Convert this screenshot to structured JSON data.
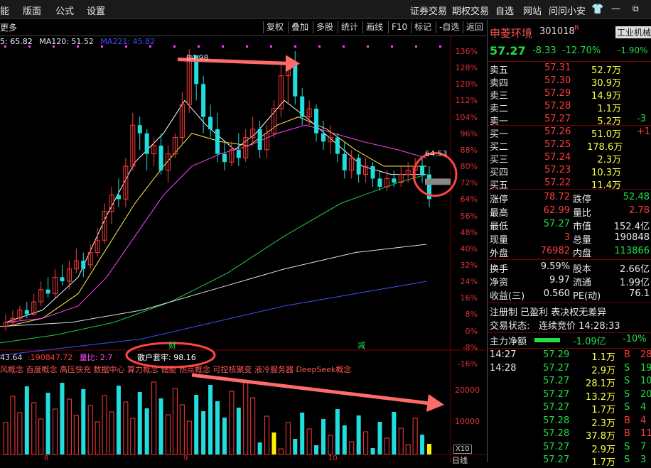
{
  "menubar": {
    "left_items": [
      "能",
      "版面",
      "公式",
      "设置"
    ],
    "right_items": [
      "证券交易",
      "期权交易",
      "自选",
      "网站",
      "问问小安"
    ]
  },
  "toolbar": {
    "more": "更多",
    "buttons": [
      "复权",
      "叠加",
      "多股",
      "统计",
      "画线",
      "F10",
      "标记",
      "-自选",
      "返回"
    ]
  },
  "ma_legend": [
    {
      "text": "5: 65.82",
      "color": "#ffffff"
    },
    {
      "text": "MA120: 51.52",
      "color": "#e8e8e8"
    },
    {
      "text": "MA221: 45.82",
      "color": "#4050ff"
    }
  ],
  "price_axis": [
    "136%",
    "128%",
    "120%",
    "112%",
    "104%",
    "96%",
    "88%",
    "80%",
    "72%",
    "64%",
    "56%",
    "48%",
    "40%",
    "32%",
    "24%",
    "16%",
    "8%",
    "0%",
    "-8%",
    "-16%"
  ],
  "annotations": {
    "high_label": "84.98",
    "current_label": "64.53",
    "marker_cai": "财",
    "marker_jian": "减"
  },
  "volume": {
    "legend_value1": "43.64",
    "legend_value2": "190847.72",
    "legend_ratio_label": "量比: 2.7",
    "retail_label": "散户套牢: 98.16",
    "concepts": "风概念 百度概念 高压快充 数据中心 算力概念 储能 热点概念 可控核聚变 液冷服务器 DeepSeek概念",
    "axis": [
      "20000",
      "10000"
    ],
    "axis_unit": "X10"
  },
  "x_axis": [
    "8",
    "9",
    "10"
  ],
  "stock": {
    "name": "申菱环境",
    "code": "301018",
    "flag": "R",
    "industry": "工业机械",
    "price": "57.27",
    "change": "-8.33",
    "change_pct": "-12.70%",
    "industry_pct": "-1.90%"
  },
  "order_book": {
    "asks": [
      {
        "label": "卖五",
        "price": "57.31",
        "vol": "52.7万",
        "ext": ""
      },
      {
        "label": "卖四",
        "price": "57.30",
        "vol": "30.9万",
        "ext": ""
      },
      {
        "label": "卖三",
        "price": "57.29",
        "vol": "14.9万",
        "ext": ""
      },
      {
        "label": "卖二",
        "price": "57.28",
        "vol": "1.1万",
        "ext": ""
      },
      {
        "label": "卖一",
        "price": "57.27",
        "vol": "5.2万",
        "ext": "-3"
      }
    ],
    "bids": [
      {
        "label": "买一",
        "price": "57.26",
        "vol": "51.0万",
        "ext": "+1"
      },
      {
        "label": "买二",
        "price": "57.25",
        "vol": "178.6万",
        "ext": ""
      },
      {
        "label": "买三",
        "price": "57.24",
        "vol": "2.3万",
        "ext": ""
      },
      {
        "label": "买四",
        "price": "57.23",
        "vol": "10.3万",
        "ext": ""
      },
      {
        "label": "买五",
        "price": "57.22",
        "vol": "11.4万",
        "ext": ""
      }
    ]
  },
  "stats": [
    {
      "l1": "涨停",
      "v1": "78.72",
      "l2": "跌停",
      "v2": "52.48",
      "c1": "red",
      "c2": "grn"
    },
    {
      "l1": "最高",
      "v1": "62.99",
      "l2": "量比",
      "v2": "2.78",
      "c1": "red",
      "c2": "red"
    },
    {
      "l1": "最低",
      "v1": "57.27",
      "l2": "市值",
      "v2": "152.4亿",
      "c1": "grn",
      "c2": "wht"
    },
    {
      "l1": "现量",
      "v1": "3",
      "l2": "总量",
      "v2": "190848",
      "c1": "red",
      "c2": "wht"
    },
    {
      "l1": "外盘",
      "v1": "76982",
      "l2": "内盘",
      "v2": "113866",
      "c1": "red",
      "c2": "grn"
    }
  ],
  "stats2": [
    {
      "l1": "换手",
      "v1": "9.59%",
      "l2": "股本",
      "v2": "2.66亿"
    },
    {
      "l1": "净资",
      "v1": "9.97",
      "l2": "流通",
      "v2": "1.99亿"
    },
    {
      "l1": "收益(三)",
      "v1": "0.560",
      "l2": "PE(动)",
      "v2": "76.1"
    }
  ],
  "info": {
    "registration": "注册制 已盈利 表决权无差异",
    "status_label": "交易状态:",
    "status_value": "连续竞价 14:28:33",
    "netflow_label": "主力净额",
    "netflow_value": "-1.09亿",
    "netflow_pct": "-10%"
  },
  "ticks": [
    {
      "time": "14:27",
      "price": "57.29",
      "vol": "1.1万",
      "side": "B",
      "n": "28"
    },
    {
      "time": "14:28",
      "price": "57.27",
      "vol": "2.9万",
      "side": "S",
      "n": "19"
    },
    {
      "time": "",
      "price": "57.27",
      "vol": "28.1万",
      "side": "S",
      "n": "10"
    },
    {
      "time": "",
      "price": "57.27",
      "vol": "13.2万",
      "side": "S",
      "n": "20"
    },
    {
      "time": "",
      "price": "57.27",
      "vol": "1.7万",
      "side": "S",
      "n": "4"
    },
    {
      "time": "",
      "price": "57.28",
      "vol": "2.3万",
      "side": "B",
      "n": "4"
    },
    {
      "time": "",
      "price": "57.28",
      "vol": "37.8万",
      "side": "B",
      "n": "11"
    },
    {
      "time": "",
      "price": "57.27",
      "vol": "2.9万",
      "side": "S",
      "n": "7"
    },
    {
      "time": "",
      "price": "57.27",
      "vol": "1.7万",
      "side": "S",
      "n": "3"
    }
  ],
  "colors": {
    "up": "#ff3b3b",
    "down": "#22dddd",
    "bg": "#000000"
  }
}
